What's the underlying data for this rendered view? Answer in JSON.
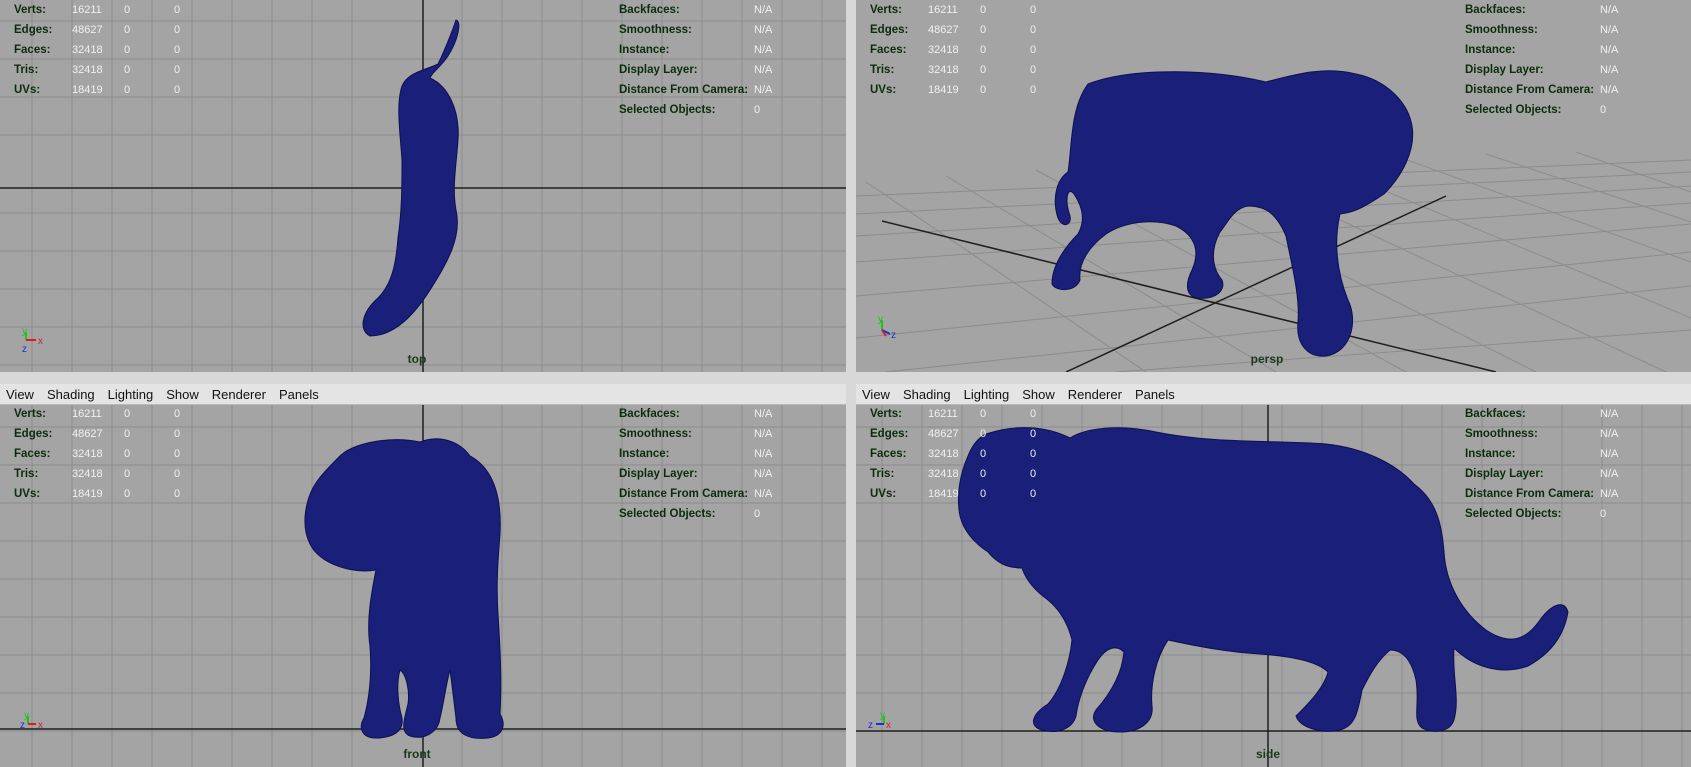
{
  "menu": [
    "View",
    "Shading",
    "Lighting",
    "Show",
    "Renderer",
    "Panels"
  ],
  "hud_left": [
    {
      "label": "Verts:",
      "v1": "16211",
      "v2": "0",
      "v3": "0"
    },
    {
      "label": "Edges:",
      "v1": "48627",
      "v2": "0",
      "v3": "0"
    },
    {
      "label": "Faces:",
      "v1": "32418",
      "v2": "0",
      "v3": "0"
    },
    {
      "label": "Tris:",
      "v1": "32418",
      "v2": "0",
      "v3": "0"
    },
    {
      "label": "UVs:",
      "v1": "18419",
      "v2": "0",
      "v3": "0"
    }
  ],
  "hud_right": [
    {
      "label": "Backfaces:",
      "value": "N/A"
    },
    {
      "label": "Smoothness:",
      "value": "N/A"
    },
    {
      "label": "Instance:",
      "value": "N/A"
    },
    {
      "label": "Display Layer:",
      "value": "N/A"
    },
    {
      "label": "Distance From Camera:",
      "value": "N/A"
    },
    {
      "label": "Selected Objects:",
      "value": "0"
    }
  ],
  "viewports": {
    "top": {
      "label": "top"
    },
    "persp": {
      "label": "persp"
    },
    "front": {
      "label": "front"
    },
    "side": {
      "label": "side"
    }
  },
  "axis_letters": {
    "x": "x",
    "y": "y",
    "z": "z"
  },
  "colors": {
    "viewport_bg": "#a4a4a4",
    "grid": "#8c8c8c",
    "axis_line": "#1e1e1e",
    "mesh": "#1a1f7a",
    "hud_label": "#0c2d0c",
    "hud_value": "#f0f0f0",
    "axis_x": "#d42020",
    "axis_y": "#22c022",
    "axis_z": "#2030d0"
  },
  "icons": {
    "axis_indicator": "xyz-axis-icon"
  }
}
